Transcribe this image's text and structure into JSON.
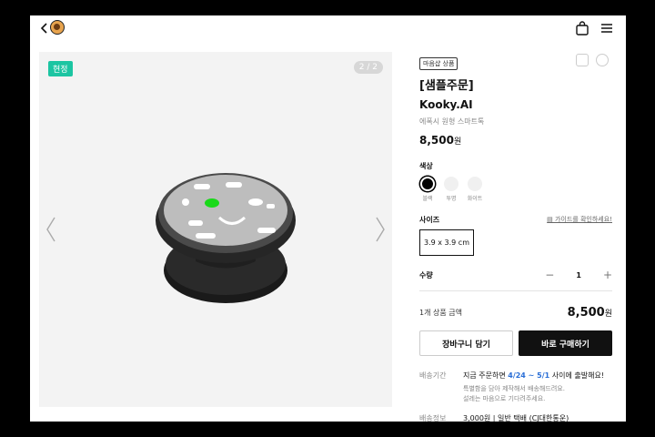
{
  "gallery": {
    "badge": "현정",
    "counter": "2 / 2"
  },
  "product": {
    "tag": "마음샵 상품",
    "title": "[샘플주문]",
    "brand": "Kooky.AI",
    "subtitle": "에폭시 원형 스마트톡",
    "price": "8,500",
    "price_unit": "원"
  },
  "options": {
    "color_label": "색상",
    "colors": [
      {
        "name": "블랙",
        "hex": "#000000"
      },
      {
        "name": "투명",
        "hex": "#f0f0f0"
      },
      {
        "name": "화이트",
        "hex": "#f0f0f0"
      }
    ],
    "size_label": "사이즈",
    "guide_link": "가이드를 확인하세요!",
    "size_value": "3.9 x 3.9 cm",
    "qty_label": "수량",
    "qty_minus": "−",
    "qty_value": "1",
    "qty_plus": "+"
  },
  "total": {
    "label": "1개 상품 금액",
    "value": "8,500",
    "unit": "원"
  },
  "actions": {
    "cart": "장바구니 담기",
    "buy": "바로 구매하기"
  },
  "shipping": {
    "period_label": "배송기간",
    "period_pre": "지금 주문하면 ",
    "period_dates": "4/24 ~ 5/1",
    "period_post": " 사이에 출발해요!",
    "note1": "특별함을 담아 제작해서 배송해드려요.",
    "note2": "설레는 마음으로 기다려주세요.",
    "info_label": "배송정보",
    "info_value": "3,000원 | 일반 택배 (CJ대한통운)"
  },
  "colors": {
    "badge": "#1cc5a2",
    "accent": "#2b6fd6",
    "buy_button": "#111111"
  }
}
